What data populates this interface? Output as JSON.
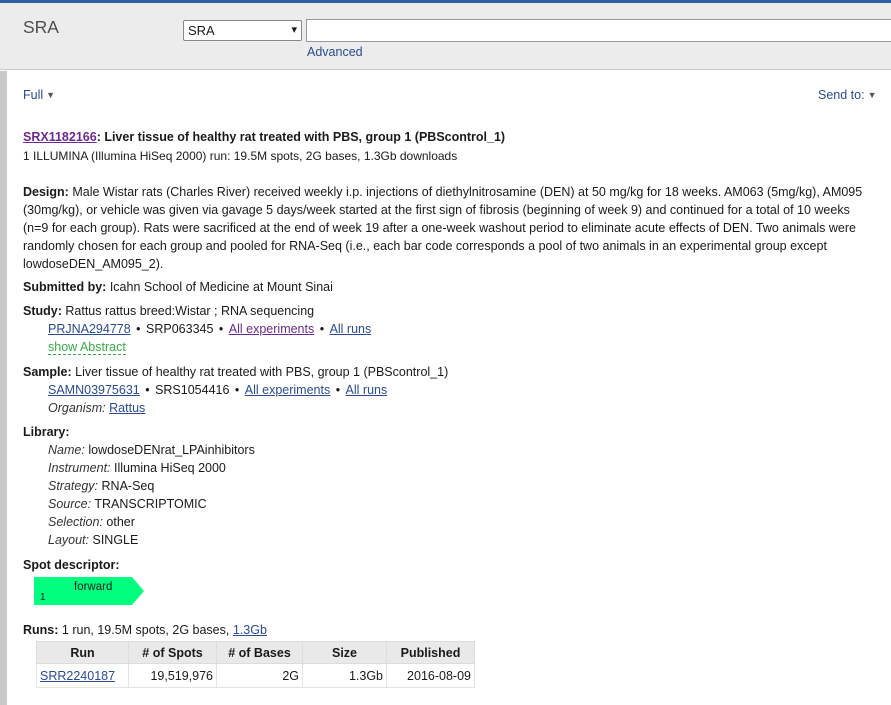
{
  "header": {
    "db_title": "SRA",
    "db_select_value": "SRA",
    "search_value": "",
    "advanced_label": "Advanced"
  },
  "toolbar": {
    "format_label": "Full",
    "send_to_label": "Send to:"
  },
  "record": {
    "accession": "SRX1182166",
    "title_rest": ": Liver tissue of healthy rat treated with PBS, group 1 (PBScontrol_1)",
    "subtitle": "1 ILLUMINA (Illumina HiSeq 2000) run: 19.5M spots, 2G bases, 1.3Gb downloads",
    "design_label": "Design:",
    "design_text": "Male Wistar rats (Charles River) received weekly i.p. injections of diethylnitrosamine (DEN) at 50 mg/kg for 18 weeks. AM063 (5mg/kg), AM095 (30mg/kg), or vehicle was given via gavage 5 days/week started at the first sign of fibrosis (beginning of week 9) and continued for a total of 10 weeks (n=9 for each group). Rats were sacrificed at the end of week 19 after a one-week washout period to eliminate acute effects of DEN. Two animals were randomly chosen for each group and pooled for RNA-Seq (i.e., each bar code corresponds a pool of two animals in an experimental group except lowdoseDEN_AM095_2).",
    "submitted_label": "Submitted by:",
    "submitted_value": "Icahn School of Medicine at Mount Sinai",
    "study_label": "Study:",
    "study_value": "Rattus rattus breed:Wistar ; RNA sequencing",
    "study_links": {
      "bioproject": "PRJNA294778",
      "srp": "SRP063345",
      "all_experiments": "All experiments",
      "all_runs": "All runs",
      "show_abstract": "show Abstract"
    },
    "sample_label": "Sample:",
    "sample_value": "Liver tissue of healthy rat treated with PBS, group 1 (PBScontrol_1)",
    "sample_links": {
      "biosample": "SAMN03975631",
      "srs": "SRS1054416",
      "all_experiments": "All experiments",
      "all_runs": "All runs"
    },
    "organism_label": "Organism:",
    "organism_value": "Rattus",
    "library_label": "Library:",
    "library": [
      {
        "label": "Name:",
        "value": "lowdoseDENrat_LPAinhibitors"
      },
      {
        "label": "Instrument:",
        "value": "Illumina HiSeq 2000"
      },
      {
        "label": "Strategy:",
        "value": "RNA-Seq"
      },
      {
        "label": "Source:",
        "value": "TRANSCRIPTOMIC"
      },
      {
        "label": "Selection:",
        "value": "other"
      },
      {
        "label": "Layout:",
        "value": "SINGLE"
      }
    ],
    "spot_label": "Spot descriptor:",
    "spot_read_label": "forward",
    "spot_read_number": "1",
    "runs_label": "Runs:",
    "runs_summary": "1 run, 19.5M spots, 2G bases,",
    "runs_size_link": "1.3Gb",
    "runs_table": {
      "headers": [
        "Run",
        "# of Spots",
        "# of Bases",
        "Size",
        "Published"
      ],
      "rows": [
        [
          "SRR2240187",
          "19,519,976",
          "2G",
          "1.3Gb",
          "2016-08-09"
        ]
      ]
    }
  },
  "colors": {
    "link": "#2a4b8d",
    "visited_link": "#6b2a8e",
    "show_abstract": "#3aa84a",
    "spot_forward": "#00ff7f",
    "header_bg": "#ececec",
    "top_bar": "#2d5ea0"
  }
}
